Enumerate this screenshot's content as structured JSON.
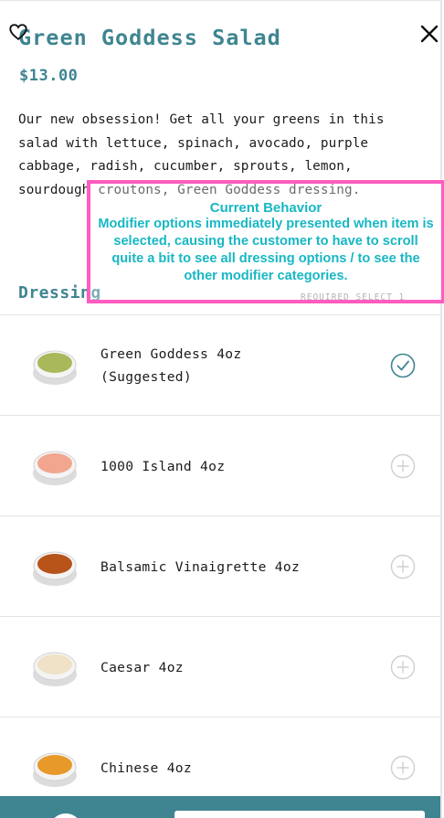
{
  "item": {
    "title": "Green Goddess Salad",
    "price": "$13.00",
    "description": "Our new obsession! Get all your greens in this salad with lettuce, spinach, avocado, purple cabbage, radish, cucumber, sprouts, lemon, sourdough croutons, Green Goddess dressing."
  },
  "modifier_section": {
    "title": "Dressing",
    "requirement": "REQUIRED SELECT 1"
  },
  "options": [
    {
      "label": "Green Goddess 4oz\n(Suggested)",
      "selected": true,
      "color": "#a9b85a"
    },
    {
      "label": "1000 Island 4oz",
      "selected": false,
      "color": "#f2a58f"
    },
    {
      "label": "Balsamic Vinaigrette 4oz",
      "selected": false,
      "color": "#b8531a"
    },
    {
      "label": "Caesar 4oz",
      "selected": false,
      "color": "#efe2c6"
    },
    {
      "label": "Chinese 4oz",
      "selected": false,
      "color": "#e79a2a"
    }
  ],
  "annotation": {
    "title": "Current Behavior",
    "text": "Modifier options immediately presented when item is selected, causing the customer to have to scroll quite a bit to see all dressing options / to see the other modifier categories."
  },
  "icons": {
    "favorite": "heart-outline-icon",
    "close": "close-x-icon",
    "selected": "check-circle-icon",
    "unselected": "plus-circle-icon"
  },
  "colors": {
    "brand": "#3f8591",
    "annotation_border": "#ff5cc0",
    "annotation_text": "#17b7c4",
    "divider": "#e3e3e3"
  }
}
